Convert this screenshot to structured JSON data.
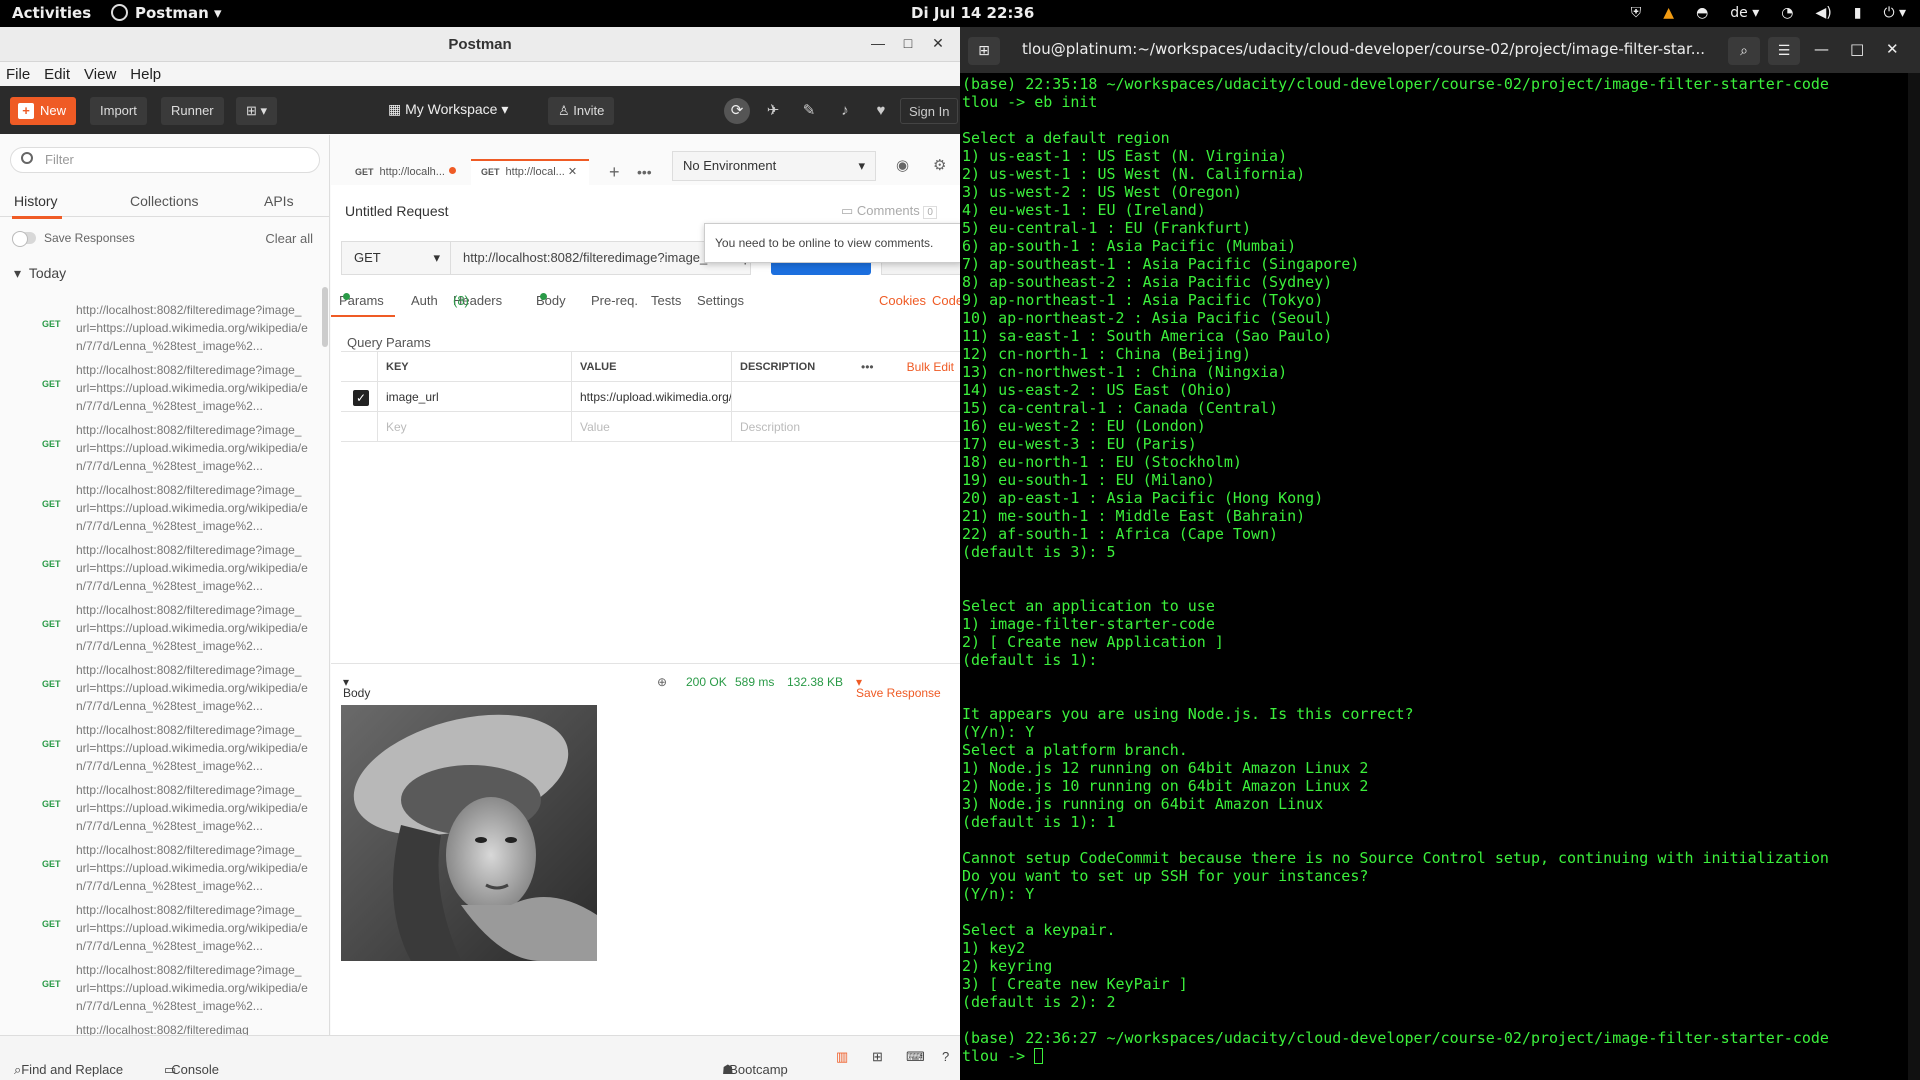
{
  "topbar": {
    "activities": "Activities",
    "app_name": "Postman",
    "clock": "Di Jul 14  22:36",
    "keyboard_layout": "de"
  },
  "postman": {
    "window_title": "Postman",
    "menu": [
      "File",
      "Edit",
      "View",
      "Help"
    ],
    "toolbar": {
      "new": "New",
      "import": "Import",
      "runner": "Runner",
      "workspace": "My Workspace",
      "invite": "Invite",
      "sign_in": "Sign In"
    },
    "sidebar": {
      "filter_placeholder": "Filter",
      "tabs": [
        "History",
        "Collections",
        "APIs"
      ],
      "save_responses": "Save Responses",
      "clear_all": "Clear all",
      "group": "Today",
      "method": "GET",
      "history_url": "http://localhost:8082/filteredimage?image_url=https://upload.wikimedia.org/wikipedia/en/7/7d/Lenna_%28test_image%2...",
      "history_url_partial": "http://localhost:8082/filteredimag"
    },
    "request_tabs": [
      {
        "method": "GET",
        "label": "http://localh..."
      },
      {
        "method": "GET",
        "label": "http://local..."
      }
    ],
    "environment": "No Environment",
    "request_title": "Untitled Request",
    "comments": "Comments",
    "comments_count": "0",
    "tooltip": "You need to be online to view comments.",
    "method": "GET",
    "url": "http://localhost:8082/filteredimage?image_url=https://upload.wikimedia.org",
    "tabs": {
      "params": "Params",
      "auth": "Auth",
      "headers": "Headers",
      "headers_count": "(8)",
      "body": "Body",
      "prereq": "Pre-req.",
      "tests": "Tests",
      "settings": "Settings",
      "cookies": "Cookies",
      "code": "Code"
    },
    "query_params": {
      "title": "Query Params",
      "headers": [
        "KEY",
        "VALUE",
        "DESCRIPTION"
      ],
      "bulk_edit": "Bulk Edit",
      "rows": [
        {
          "key": "image_url",
          "value": "https://upload.wikimedia.org/wikipedia/en/7/7d/Lenna"
        }
      ],
      "placeholders": {
        "key": "Key",
        "value": "Value",
        "description": "Description"
      }
    },
    "response": {
      "body_label": "Body",
      "status": "200 OK",
      "time": "589 ms",
      "size": "132.38 KB",
      "save_response": "Save Response"
    },
    "footer": {
      "find_replace": "Find and Replace",
      "console": "Console",
      "bootcamp": "Bootcamp"
    }
  },
  "terminal": {
    "title": "tlou@platinum:~/workspaces/udacity/cloud-developer/course-02/project/image-filter-star...",
    "lines": [
      "(base) 22:35:18 ~/workspaces/udacity/cloud-developer/course-02/project/image-filter-starter-code",
      "tlou -> eb init",
      "",
      "Select a default region",
      "1) us-east-1 : US East (N. Virginia)",
      "2) us-west-1 : US West (N. California)",
      "3) us-west-2 : US West (Oregon)",
      "4) eu-west-1 : EU (Ireland)",
      "5) eu-central-1 : EU (Frankfurt)",
      "6) ap-south-1 : Asia Pacific (Mumbai)",
      "7) ap-southeast-1 : Asia Pacific (Singapore)",
      "8) ap-southeast-2 : Asia Pacific (Sydney)",
      "9) ap-northeast-1 : Asia Pacific (Tokyo)",
      "10) ap-northeast-2 : Asia Pacific (Seoul)",
      "11) sa-east-1 : South America (Sao Paulo)",
      "12) cn-north-1 : China (Beijing)",
      "13) cn-northwest-1 : China (Ningxia)",
      "14) us-east-2 : US East (Ohio)",
      "15) ca-central-1 : Canada (Central)",
      "16) eu-west-2 : EU (London)",
      "17) eu-west-3 : EU (Paris)",
      "18) eu-north-1 : EU (Stockholm)",
      "19) eu-south-1 : EU (Milano)",
      "20) ap-east-1 : Asia Pacific (Hong Kong)",
      "21) me-south-1 : Middle East (Bahrain)",
      "22) af-south-1 : Africa (Cape Town)",
      "(default is 3): 5",
      "",
      "",
      "Select an application to use",
      "1) image-filter-starter-code",
      "2) [ Create new Application ]",
      "(default is 1):",
      "",
      "",
      "It appears you are using Node.js. Is this correct?",
      "(Y/n): Y",
      "Select a platform branch.",
      "1) Node.js 12 running on 64bit Amazon Linux 2",
      "2) Node.js 10 running on 64bit Amazon Linux 2",
      "3) Node.js running on 64bit Amazon Linux",
      "(default is 1): 1",
      "",
      "Cannot setup CodeCommit because there is no Source Control setup, continuing with initialization",
      "Do you want to set up SSH for your instances?",
      "(Y/n): Y",
      "",
      "Select a keypair.",
      "1) key2",
      "2) keyring",
      "3) [ Create new KeyPair ]",
      "(default is 2): 2",
      "",
      "(base) 22:36:27 ~/workspaces/udacity/cloud-developer/course-02/project/image-filter-starter-code"
    ],
    "prompt": "tlou -> "
  },
  "colors": {
    "accent": "#ef5b25",
    "send": "#1c6fde",
    "success": "#2a9a47",
    "terminal_text": "#3cf03c"
  }
}
